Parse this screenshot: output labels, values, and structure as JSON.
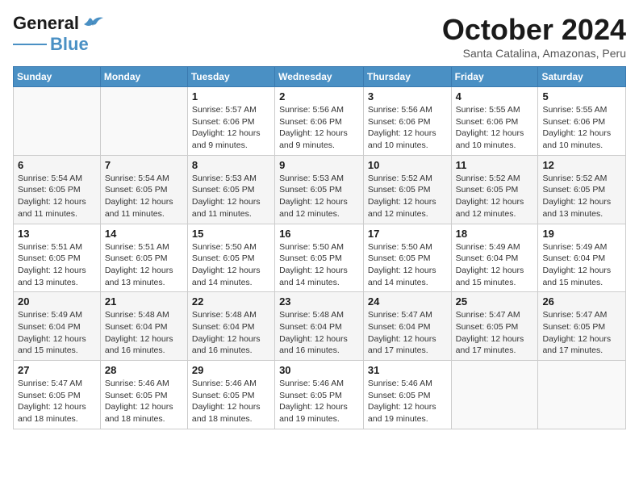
{
  "logo": {
    "line1": "General",
    "line2": "Blue"
  },
  "title": "October 2024",
  "subtitle": "Santa Catalina, Amazonas, Peru",
  "weekdays": [
    "Sunday",
    "Monday",
    "Tuesday",
    "Wednesday",
    "Thursday",
    "Friday",
    "Saturday"
  ],
  "weeks": [
    [
      {
        "day": "",
        "info": ""
      },
      {
        "day": "",
        "info": ""
      },
      {
        "day": "1",
        "info": "Sunrise: 5:57 AM\nSunset: 6:06 PM\nDaylight: 12 hours and 9 minutes."
      },
      {
        "day": "2",
        "info": "Sunrise: 5:56 AM\nSunset: 6:06 PM\nDaylight: 12 hours and 9 minutes."
      },
      {
        "day": "3",
        "info": "Sunrise: 5:56 AM\nSunset: 6:06 PM\nDaylight: 12 hours and 10 minutes."
      },
      {
        "day": "4",
        "info": "Sunrise: 5:55 AM\nSunset: 6:06 PM\nDaylight: 12 hours and 10 minutes."
      },
      {
        "day": "5",
        "info": "Sunrise: 5:55 AM\nSunset: 6:06 PM\nDaylight: 12 hours and 10 minutes."
      }
    ],
    [
      {
        "day": "6",
        "info": "Sunrise: 5:54 AM\nSunset: 6:05 PM\nDaylight: 12 hours and 11 minutes."
      },
      {
        "day": "7",
        "info": "Sunrise: 5:54 AM\nSunset: 6:05 PM\nDaylight: 12 hours and 11 minutes."
      },
      {
        "day": "8",
        "info": "Sunrise: 5:53 AM\nSunset: 6:05 PM\nDaylight: 12 hours and 11 minutes."
      },
      {
        "day": "9",
        "info": "Sunrise: 5:53 AM\nSunset: 6:05 PM\nDaylight: 12 hours and 12 minutes."
      },
      {
        "day": "10",
        "info": "Sunrise: 5:52 AM\nSunset: 6:05 PM\nDaylight: 12 hours and 12 minutes."
      },
      {
        "day": "11",
        "info": "Sunrise: 5:52 AM\nSunset: 6:05 PM\nDaylight: 12 hours and 12 minutes."
      },
      {
        "day": "12",
        "info": "Sunrise: 5:52 AM\nSunset: 6:05 PM\nDaylight: 12 hours and 13 minutes."
      }
    ],
    [
      {
        "day": "13",
        "info": "Sunrise: 5:51 AM\nSunset: 6:05 PM\nDaylight: 12 hours and 13 minutes."
      },
      {
        "day": "14",
        "info": "Sunrise: 5:51 AM\nSunset: 6:05 PM\nDaylight: 12 hours and 13 minutes."
      },
      {
        "day": "15",
        "info": "Sunrise: 5:50 AM\nSunset: 6:05 PM\nDaylight: 12 hours and 14 minutes."
      },
      {
        "day": "16",
        "info": "Sunrise: 5:50 AM\nSunset: 6:05 PM\nDaylight: 12 hours and 14 minutes."
      },
      {
        "day": "17",
        "info": "Sunrise: 5:50 AM\nSunset: 6:05 PM\nDaylight: 12 hours and 14 minutes."
      },
      {
        "day": "18",
        "info": "Sunrise: 5:49 AM\nSunset: 6:04 PM\nDaylight: 12 hours and 15 minutes."
      },
      {
        "day": "19",
        "info": "Sunrise: 5:49 AM\nSunset: 6:04 PM\nDaylight: 12 hours and 15 minutes."
      }
    ],
    [
      {
        "day": "20",
        "info": "Sunrise: 5:49 AM\nSunset: 6:04 PM\nDaylight: 12 hours and 15 minutes."
      },
      {
        "day": "21",
        "info": "Sunrise: 5:48 AM\nSunset: 6:04 PM\nDaylight: 12 hours and 16 minutes."
      },
      {
        "day": "22",
        "info": "Sunrise: 5:48 AM\nSunset: 6:04 PM\nDaylight: 12 hours and 16 minutes."
      },
      {
        "day": "23",
        "info": "Sunrise: 5:48 AM\nSunset: 6:04 PM\nDaylight: 12 hours and 16 minutes."
      },
      {
        "day": "24",
        "info": "Sunrise: 5:47 AM\nSunset: 6:04 PM\nDaylight: 12 hours and 17 minutes."
      },
      {
        "day": "25",
        "info": "Sunrise: 5:47 AM\nSunset: 6:05 PM\nDaylight: 12 hours and 17 minutes."
      },
      {
        "day": "26",
        "info": "Sunrise: 5:47 AM\nSunset: 6:05 PM\nDaylight: 12 hours and 17 minutes."
      }
    ],
    [
      {
        "day": "27",
        "info": "Sunrise: 5:47 AM\nSunset: 6:05 PM\nDaylight: 12 hours and 18 minutes."
      },
      {
        "day": "28",
        "info": "Sunrise: 5:46 AM\nSunset: 6:05 PM\nDaylight: 12 hours and 18 minutes."
      },
      {
        "day": "29",
        "info": "Sunrise: 5:46 AM\nSunset: 6:05 PM\nDaylight: 12 hours and 18 minutes."
      },
      {
        "day": "30",
        "info": "Sunrise: 5:46 AM\nSunset: 6:05 PM\nDaylight: 12 hours and 19 minutes."
      },
      {
        "day": "31",
        "info": "Sunrise: 5:46 AM\nSunset: 6:05 PM\nDaylight: 12 hours and 19 minutes."
      },
      {
        "day": "",
        "info": ""
      },
      {
        "day": "",
        "info": ""
      }
    ]
  ]
}
